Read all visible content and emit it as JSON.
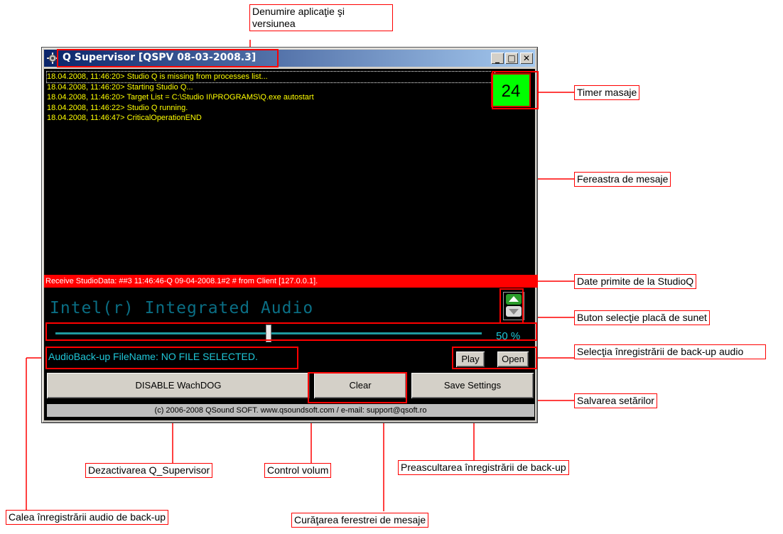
{
  "window": {
    "title": "Q Supervisor [QSPV 08-03-2008.3]",
    "controls": {
      "minimize": "_",
      "maximize": "□",
      "close": "✕"
    }
  },
  "log": {
    "lines": [
      "18.04.2008, 11:46:20> Studio Q is missing from processes list...",
      "18.04.2008, 11:46:20> Starting Studio Q...",
      "18.04.2008, 11:46:20> Target List = C:\\Studio II\\PROGRAMS\\Q.exe autostart",
      "18.04.2008, 11:46:22> Studio Q running.",
      "",
      "18.04.2008, 11:46:47> CriticalOperationEND"
    ]
  },
  "timer": {
    "value": "24"
  },
  "status": {
    "text": "Receive StudioData: ##3 11:46:46-Q 09-04-2008.1#2 # from Client [127.0.0.1]."
  },
  "soundcard": {
    "name": "Intel(r) Integrated Audio"
  },
  "volume": {
    "label": "50 %",
    "value": 0.5
  },
  "backup": {
    "filename_text": "AudioBack-up FileName: NO FILE SELECTED."
  },
  "buttons": {
    "play": "Play",
    "open": "Open",
    "disable": "DISABLE WachDOG",
    "clear": "Clear",
    "save": "Save Settings"
  },
  "footer": {
    "text": "(c) 2006-2008 QSound SOFT. www.qsoundsoft.com / e-mail: support@qsoft.ro"
  },
  "annotations": {
    "app_name": "Denumire aplicaţie şi versiunea",
    "timer": "Timer masaje",
    "message_window": "Fereastra de mesaje",
    "studioq_data": "Date primite de la StudioQ",
    "soundcard_button": "Buton selecţie placă de sunet",
    "backup_selection": "Selecţia înregistrării de back-up audio",
    "save_settings": "Salvarea setărilor",
    "disable": "Dezactivarea Q_Supervisor",
    "volume": "Control volum",
    "prelisten": "Preascultarea înregistrării de back-up",
    "backup_path": "Calea înregistrării audio de back-up",
    "clear": "Curăţarea ferestrei de mesaje"
  },
  "colors": {
    "annotation_red": "#ff0000",
    "log_text": "#ffff00",
    "timer_bg": "#00ff00",
    "status_bg": "#ff0000",
    "cyan_text": "#1fc7d8"
  }
}
